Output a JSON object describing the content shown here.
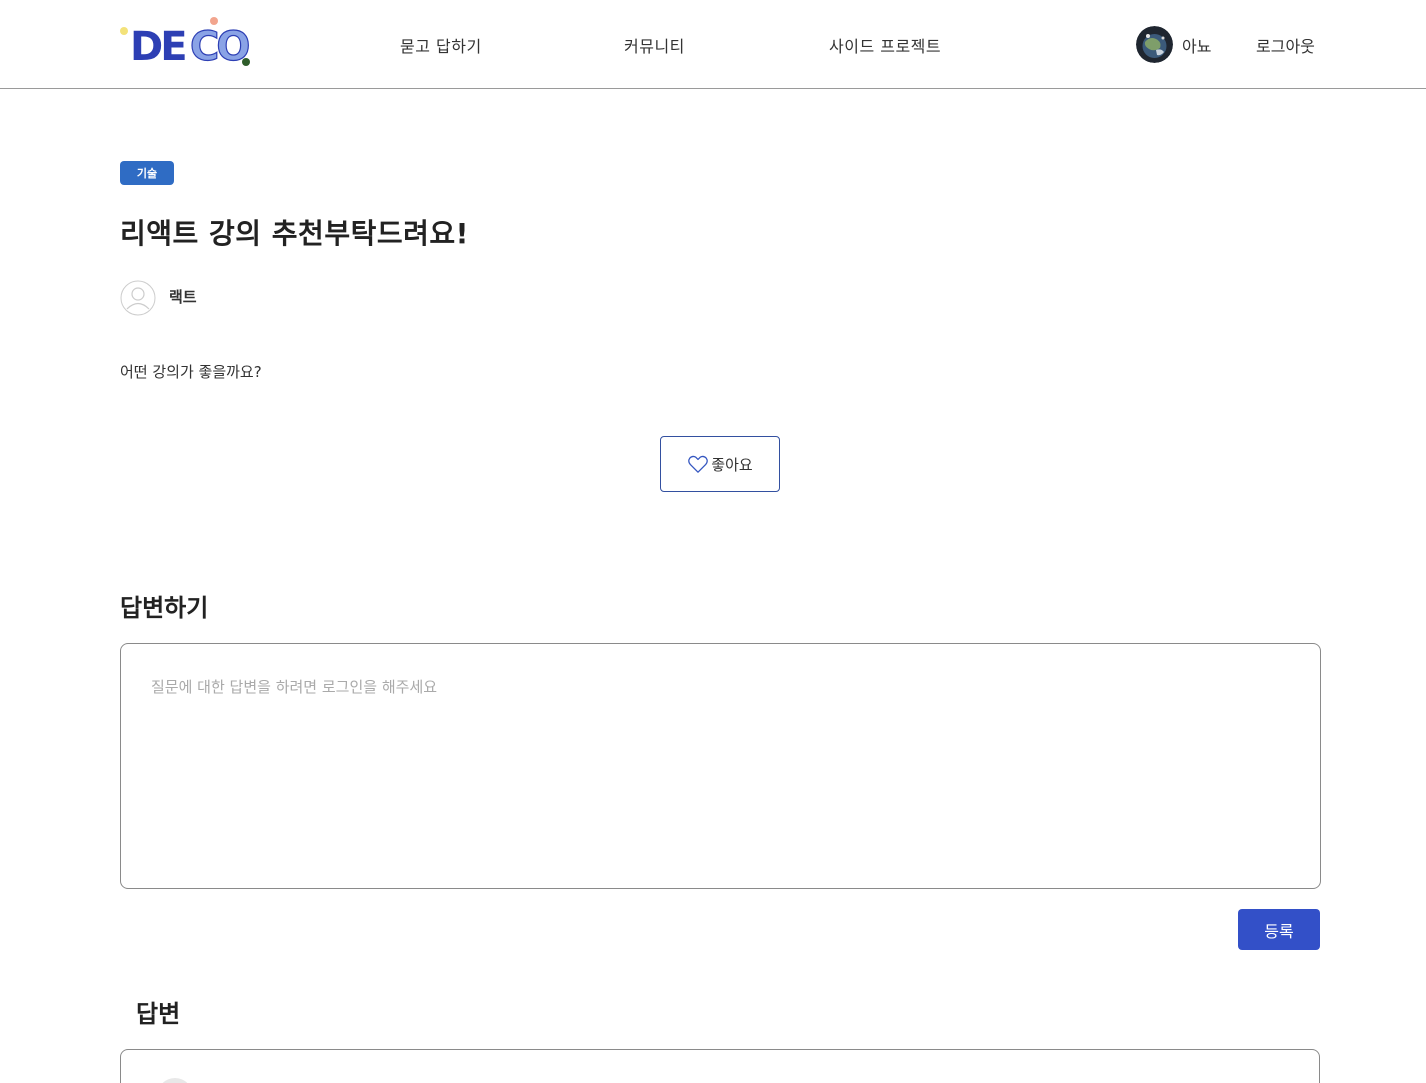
{
  "header": {
    "logo_text": "DECO",
    "nav": [
      {
        "label": "묻고 답하기"
      },
      {
        "label": "커뮤니티"
      },
      {
        "label": "사이드 프로젝트"
      }
    ],
    "user": {
      "name": "아뇨",
      "avatar": "globe-avatar-icon"
    },
    "logout_label": "로그아웃"
  },
  "post": {
    "category": "기술",
    "title": "리액트 강의 추천부탁드려요!",
    "author": {
      "name": "랙트",
      "avatar": "default-user-icon"
    },
    "body": "어떤 강의가 좋을까요?",
    "like_label": "좋아요"
  },
  "answer_form": {
    "heading": "답변하기",
    "placeholder": "질문에 대한 답변을 하려면 로그인을 해주세요",
    "submit_label": "등록"
  },
  "answers": {
    "heading": "답변"
  },
  "colors": {
    "category_badge": "#2f6cc4",
    "submit_button": "#3350c8",
    "like_border": "#3350a0",
    "logo_blue": "#2d3fb4",
    "logo_light_blue": "#8aa3e6"
  }
}
